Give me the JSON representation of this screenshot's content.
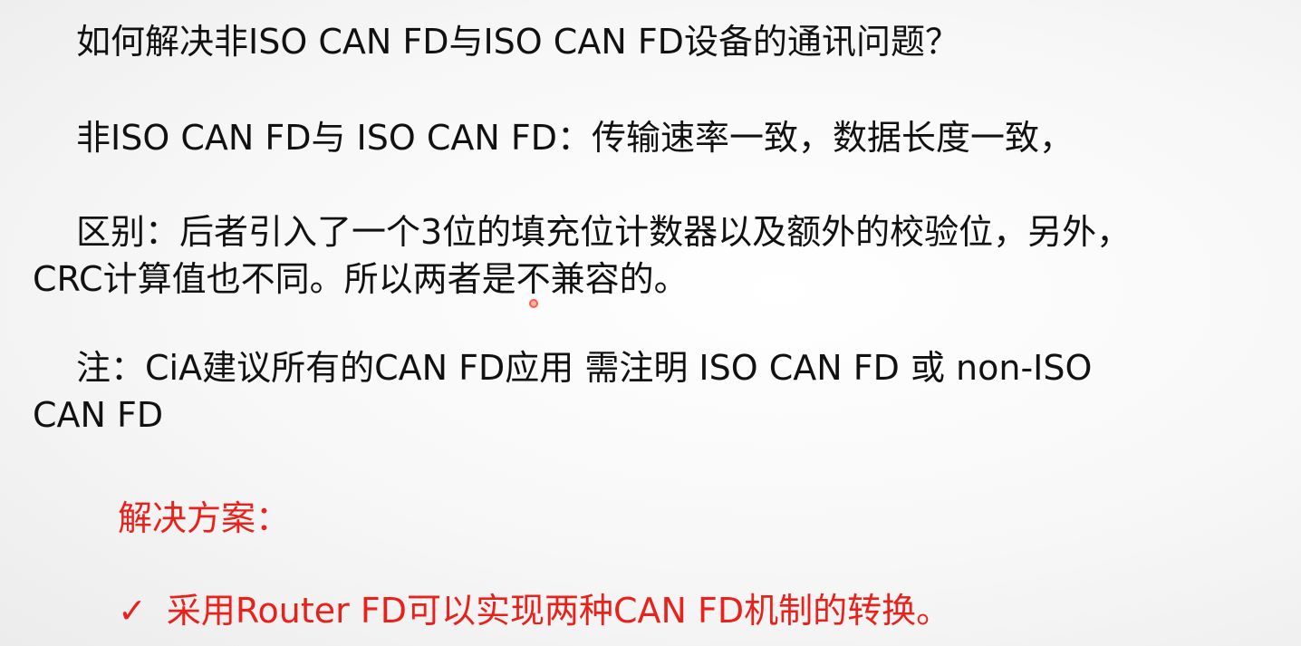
{
  "slide": {
    "question": "如何解决非ISO CAN FD与ISO CAN FD设备的通讯问题？",
    "comparison": "非ISO CAN FD与 ISO CAN FD：传输速率一致，数据长度一致，",
    "difference": {
      "line1": "区别：后者引入了一个3位的填充位计数器以及额外的校验位，另外，",
      "line2": "CRC计算值也不同。所以两者是不兼容的。"
    },
    "note": {
      "line1": "注：CiA建议所有的CAN FD应用 需注明 ISO CAN FD 或 non-ISO",
      "line2": "CAN FD"
    },
    "solution_heading": "解决方案：",
    "solution_item": "采用Router FD可以实现两种CAN FD机制的转换。",
    "check_glyph": "✓"
  },
  "colors": {
    "text": "#111111",
    "accent_red": "#e8221b",
    "cursor": "#ff5a4a"
  }
}
